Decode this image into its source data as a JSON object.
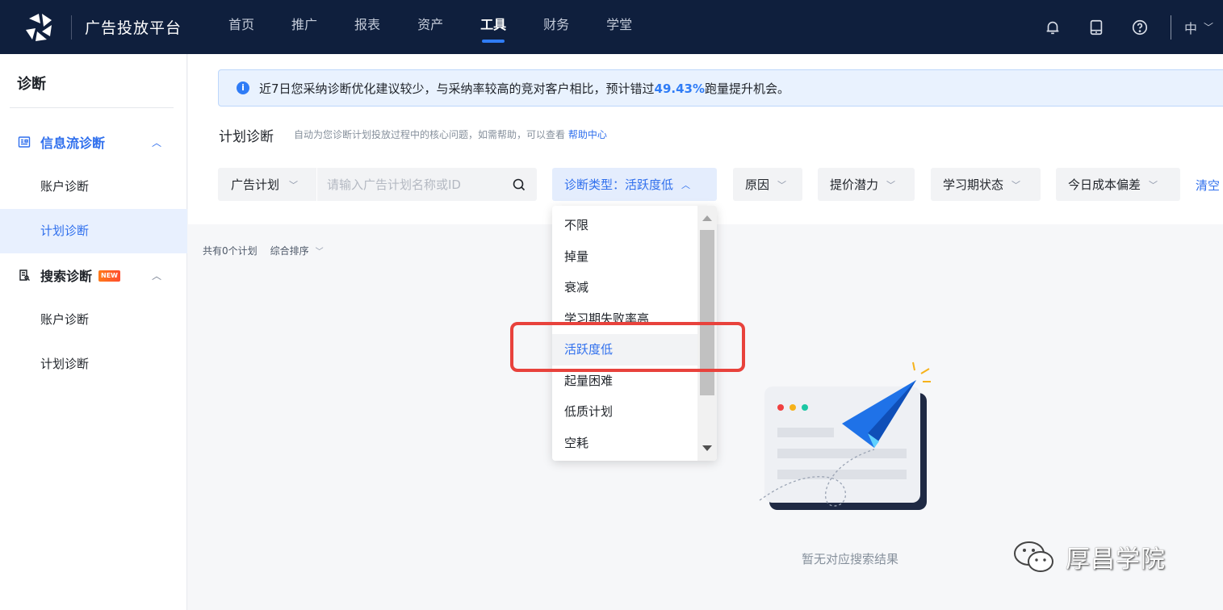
{
  "topbar": {
    "brand": "广告投放平台",
    "nav": [
      {
        "label": "首页",
        "active": false
      },
      {
        "label": "推广",
        "active": false
      },
      {
        "label": "报表",
        "active": false
      },
      {
        "label": "资产",
        "active": false
      },
      {
        "label": "工具",
        "active": true
      },
      {
        "label": "财务",
        "active": false
      },
      {
        "label": "学堂",
        "active": false
      }
    ],
    "icons": [
      "bell-icon",
      "tablet-icon",
      "help-icon"
    ],
    "language": "中"
  },
  "sidebar": {
    "title": "诊断",
    "groups": [
      {
        "label": "信息流诊断",
        "icon": "feed-icon",
        "expanded": true,
        "items": [
          {
            "label": "账户诊断",
            "active": false
          },
          {
            "label": "计划诊断",
            "active": true
          }
        ]
      },
      {
        "label": "搜索诊断",
        "icon": "search-doc-icon",
        "badge": "NEW",
        "expanded": true,
        "items": [
          {
            "label": "账户诊断",
            "active": false
          },
          {
            "label": "计划诊断",
            "active": false
          }
        ]
      }
    ]
  },
  "notice": {
    "text_before": "近7日您采纳诊断优化建议较少，与采纳率较高的竞对客户相比，预计错过",
    "highlight": "49.43%",
    "text_after": "跑量提升机会。"
  },
  "section": {
    "title": "计划诊断",
    "desc": "自动为您诊断计划投放过程中的核心问题，如需帮助，可以查看",
    "help_link": "帮助中心"
  },
  "filters": {
    "scope_select": "广告计划",
    "search_placeholder": "请输入广告计划名称或ID",
    "diagnosis_type": "诊断类型：活跃度低",
    "reason": "原因",
    "bid_potential": "提价潜力",
    "learning_status": "学习期状态",
    "cost_deviation": "今日成本偏差",
    "clear": "清空"
  },
  "list": {
    "count_text": "共有0个计划",
    "sort_label": "综合排序"
  },
  "dropdown": {
    "options": [
      "不限",
      "掉量",
      "衰减",
      "学习期失败率高",
      "活跃度低",
      "起量困难",
      "低质计划",
      "空耗"
    ],
    "selected_index": 4
  },
  "empty": {
    "text": "暂无对应搜索结果"
  },
  "watermark": {
    "text": "厚昌学院"
  },
  "colors": {
    "nav_bg": "#0f1f3d",
    "accent": "#2f6fed",
    "highlight_box": "#e8423c"
  }
}
